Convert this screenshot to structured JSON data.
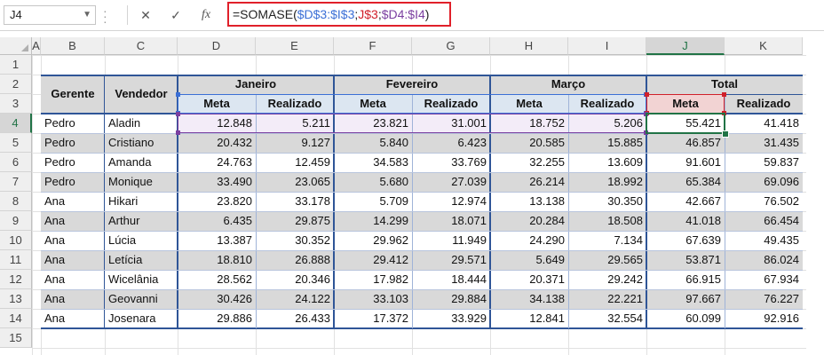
{
  "formula_bar": {
    "name_box": "J4",
    "cancel_icon": "✕",
    "enter_icon": "✓",
    "fx_label": "fx",
    "formula_parts": [
      {
        "text": "=SOMASE(",
        "color": "default"
      },
      {
        "text": "$D$3:$I$3",
        "color": "blue"
      },
      {
        "text": ";",
        "color": "default"
      },
      {
        "text": "J$3",
        "color": "red"
      },
      {
        "text": ";",
        "color": "default"
      },
      {
        "text": "$D4:$I4",
        "color": "purple"
      },
      {
        "text": ")",
        "color": "default"
      }
    ]
  },
  "colors": {
    "header_fill": "#d9d9d9",
    "subheader_fill": "#dce6f1",
    "band_fill": "#d9d9d9",
    "border_blue": "#2f5597",
    "ref_blue": "#3b6fd6",
    "ref_red": "#d0202a",
    "ref_purple": "#7b3fa0",
    "selection_green": "#217346"
  },
  "columns": [
    "A",
    "B",
    "C",
    "D",
    "E",
    "F",
    "G",
    "H",
    "I",
    "J",
    "K"
  ],
  "selected_column": "J",
  "rows": [
    "1",
    "2",
    "3",
    "4",
    "5",
    "6",
    "7",
    "8",
    "9",
    "10",
    "11",
    "12",
    "13",
    "14",
    "15"
  ],
  "selected_row": "4",
  "table": {
    "header_gerente": "Gerente",
    "header_vendedor": "Vendedor",
    "groups": [
      "Janeiro",
      "Fevereiro",
      "Março",
      "Total"
    ],
    "subheaders": [
      "Meta",
      "Realizado",
      "Meta",
      "Realizado",
      "Meta",
      "Realizado",
      "Meta",
      "Realizado"
    ],
    "data": [
      [
        "Pedro",
        "Aladin",
        "12.848",
        "5.211",
        "23.821",
        "31.001",
        "18.752",
        "5.206",
        "55.421",
        "41.418"
      ],
      [
        "Pedro",
        "Cristiano",
        "20.432",
        "9.127",
        "5.840",
        "6.423",
        "20.585",
        "15.885",
        "46.857",
        "31.435"
      ],
      [
        "Pedro",
        "Amanda",
        "24.763",
        "12.459",
        "34.583",
        "33.769",
        "32.255",
        "13.609",
        "91.601",
        "59.837"
      ],
      [
        "Pedro",
        "Monique",
        "33.490",
        "23.065",
        "5.680",
        "27.039",
        "26.214",
        "18.992",
        "65.384",
        "69.096"
      ],
      [
        "Ana",
        "Hikari",
        "23.820",
        "33.178",
        "5.709",
        "12.974",
        "13.138",
        "30.350",
        "42.667",
        "76.502"
      ],
      [
        "Ana",
        "Arthur",
        "6.435",
        "29.875",
        "14.299",
        "18.071",
        "20.284",
        "18.508",
        "41.018",
        "66.454"
      ],
      [
        "Ana",
        "Lúcia",
        "13.387",
        "30.352",
        "29.962",
        "11.949",
        "24.290",
        "7.134",
        "67.639",
        "49.435"
      ],
      [
        "Ana",
        "Letícia",
        "18.810",
        "26.888",
        "29.412",
        "29.571",
        "5.649",
        "29.565",
        "53.871",
        "86.024"
      ],
      [
        "Ana",
        "Wicelânia",
        "28.562",
        "20.346",
        "17.982",
        "18.444",
        "20.371",
        "29.242",
        "66.915",
        "67.934"
      ],
      [
        "Ana",
        "Geovanni",
        "30.426",
        "24.122",
        "33.103",
        "29.884",
        "34.138",
        "22.221",
        "97.667",
        "76.227"
      ],
      [
        "Ana",
        "Josenara",
        "29.886",
        "26.433",
        "17.372",
        "33.929",
        "12.841",
        "32.554",
        "60.099",
        "92.916"
      ]
    ]
  }
}
